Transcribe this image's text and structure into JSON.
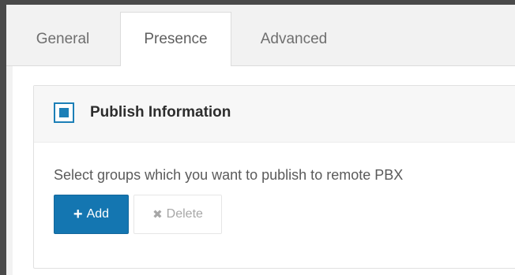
{
  "tabs": [
    {
      "label": "General"
    },
    {
      "label": "Presence"
    },
    {
      "label": "Advanced"
    }
  ],
  "active_tab": "Presence",
  "panel": {
    "title": "Publish Information",
    "checkbox_checked": true,
    "description": "Select groups which you want to publish to remote PBX",
    "add_label": "Add",
    "add_icon": "plus-icon",
    "delete_label": "Delete",
    "delete_icon": "x-icon",
    "delete_disabled": true
  },
  "colors": {
    "accent": "#1476b1",
    "checkbox": "#1c7fb7"
  }
}
